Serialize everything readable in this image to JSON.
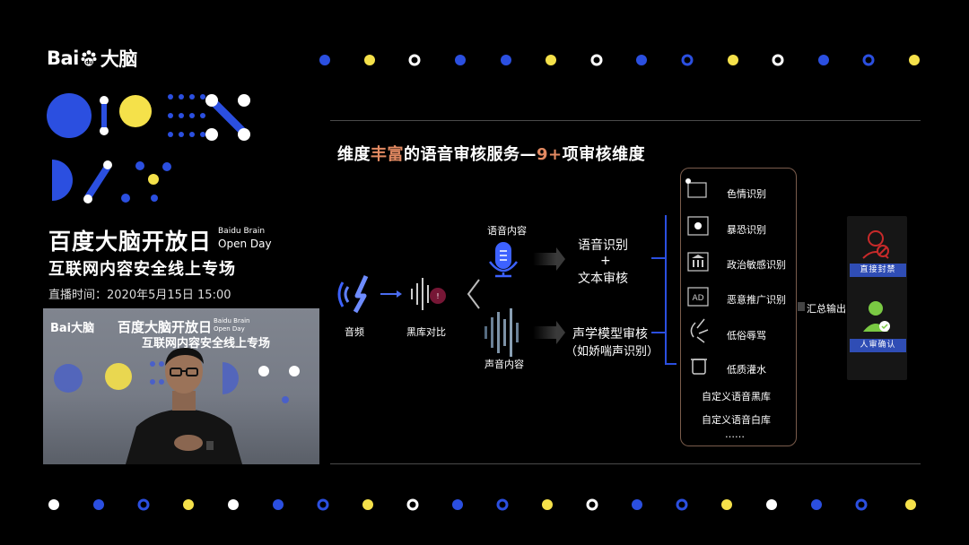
{
  "brand": {
    "logo_text": "Bai",
    "logo_text_2": "du",
    "logo_cn": "大脑"
  },
  "event": {
    "title": "百度大脑开放日",
    "title_en_1": "Baidu Brain",
    "title_en_2": "Open Day",
    "subtitle": "互联网内容安全线上专场",
    "time": "直播时间：2020年5月15日  15:00"
  },
  "video": {
    "logo": "Bai大脑",
    "title": "百度大脑开放日",
    "en_1": "Baidu Brain",
    "en_2": "Open Day",
    "subtitle": "互联网内容安全线上专场"
  },
  "slide": {
    "title_pre": "维度",
    "title_hl": "丰富",
    "title_mid": "的语音审核服务—",
    "title_hl2": "9+",
    "title_post": "项审核维度",
    "audio_label": "音频",
    "blacklist_label": "黑库对比",
    "voice_content": "语音内容",
    "sound_content": "声音内容",
    "asr_line1": "语音识别",
    "asr_plus": "+",
    "asr_line2": "文本审核",
    "acoustic_line1": "声学模型审核",
    "acoustic_line2": "（如娇喘声识别）",
    "summary_label": "汇总输出",
    "categories": [
      {
        "label": "色情识别",
        "icon": "porn-icon"
      },
      {
        "label": "暴恐识别",
        "icon": "terror-icon"
      },
      {
        "label": "政治敏感识别",
        "icon": "politics-icon"
      },
      {
        "label": "恶意推广识别",
        "icon": "ad-icon"
      },
      {
        "label": "低俗辱骂",
        "icon": "abuse-icon"
      },
      {
        "label": "低质灌水",
        "icon": "spam-icon"
      }
    ],
    "custom_black": "自定义语音黑库",
    "custom_white": "自定义语音白库",
    "ellipsis": "……",
    "block_tag": "直接封禁",
    "review_tag": "人审确认"
  },
  "colors": {
    "accent_blue": "#2b4fe0",
    "accent_yellow": "#f5e14a",
    "highlight": "#e38a62",
    "tag_blue": "#2f4db5"
  }
}
